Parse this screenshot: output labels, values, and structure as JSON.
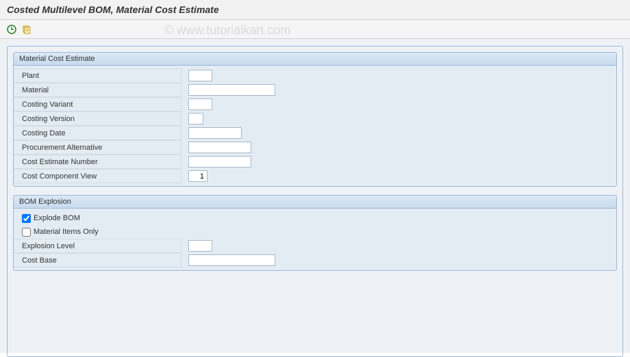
{
  "header": {
    "title": "Costed Multilevel BOM, Material Cost Estimate"
  },
  "watermark": "© www.tutorialkart.com",
  "groups": {
    "material_cost_estimate": {
      "title": "Material Cost Estimate",
      "fields": {
        "plant": {
          "label": "Plant",
          "value": ""
        },
        "material": {
          "label": "Material",
          "value": ""
        },
        "costing_variant": {
          "label": "Costing Variant",
          "value": ""
        },
        "costing_version": {
          "label": "Costing Version",
          "value": ""
        },
        "costing_date": {
          "label": "Costing Date",
          "value": ""
        },
        "procurement_alternative": {
          "label": "Procurement Alternative",
          "value": ""
        },
        "cost_estimate_number": {
          "label": "Cost Estimate Number",
          "value": ""
        },
        "cost_component_view": {
          "label": "Cost Component View",
          "value": "1"
        }
      }
    },
    "bom_explosion": {
      "title": "BOM Explosion",
      "explode_bom": {
        "label": "Explode BOM",
        "checked": true
      },
      "material_items_only": {
        "label": "Material Items Only",
        "checked": false
      },
      "fields": {
        "explosion_level": {
          "label": "Explosion Level",
          "value": ""
        },
        "cost_base": {
          "label": "Cost Base",
          "value": ""
        }
      }
    }
  },
  "icons": {
    "execute": "execute-icon",
    "variant": "variant-icon"
  }
}
